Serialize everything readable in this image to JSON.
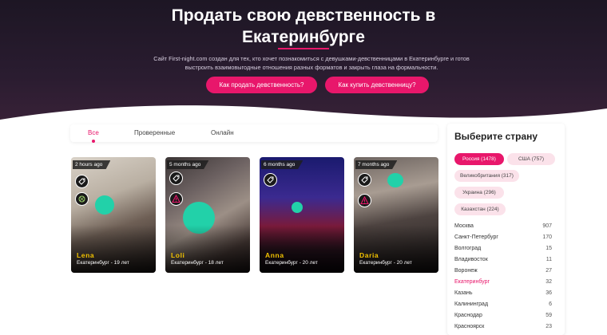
{
  "hero": {
    "title_line1": "Продать свою девственность в",
    "title_line2": "Екатеринбурге",
    "description_line1": "Сайт First-night.com создан для тех, кто хочет познакомиться с девушками-девственницами в Екатеринбурге и готов",
    "description_line2": "выстроить взаимовыгодные отношения разных форматов и закрыть глаза на формальности.",
    "btn_sell": "Как продать девственность?",
    "btn_buy": "Как купить девственницу?",
    "accent_color": "#e8176b"
  },
  "tabs": [
    {
      "label": "Все",
      "active": true
    },
    {
      "label": "Проверенные"
    },
    {
      "label": "Онлайн"
    }
  ],
  "cards": [
    {
      "time": "2 hours ago",
      "name": "Lena",
      "city": "Екатеринбург - 19 лет",
      "badges": [
        "verified-tag-icon",
        "zodiac-icon"
      ]
    },
    {
      "time": "5 months ago",
      "name": "Loli",
      "city": "Екатеринбург - 18 лет",
      "badges": [
        "verified-tag-icon",
        "warning-icon"
      ]
    },
    {
      "time": "6 months ago",
      "name": "Anna",
      "city": "Екатеринбург - 20 лет",
      "badges": [
        "verified-tag-icon"
      ]
    },
    {
      "time": "7 months ago",
      "name": "Daria",
      "city": "Екатеринбург - 20 лет",
      "badges": [
        "verified-tag-icon",
        "warning-icon"
      ]
    }
  ],
  "sidebar": {
    "title": "Выберите страну",
    "countries": [
      {
        "label": "Россия (1478)",
        "active": true
      },
      {
        "label": "США (757)"
      },
      {
        "label": "Великобритания (317)"
      },
      {
        "label": "Украина (296)"
      },
      {
        "label": "Казахстан (224)"
      }
    ],
    "cities": [
      {
        "name": "Москва",
        "count": "907"
      },
      {
        "name": "Санкт-Петербург",
        "count": "170"
      },
      {
        "name": "Волгоград",
        "count": "15"
      },
      {
        "name": "Владивосток",
        "count": "11"
      },
      {
        "name": "Воронеж",
        "count": "27"
      },
      {
        "name": "Екатеринбург",
        "count": "32",
        "active": true
      },
      {
        "name": "Казань",
        "count": "36"
      },
      {
        "name": "Калининград",
        "count": "6"
      },
      {
        "name": "Краснодар",
        "count": "59"
      },
      {
        "name": "Красноярск",
        "count": "23"
      }
    ]
  }
}
